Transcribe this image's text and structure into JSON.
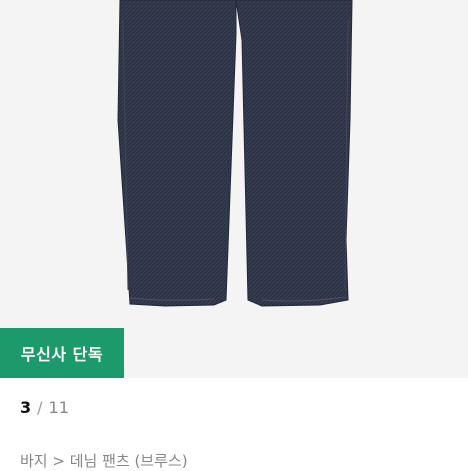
{
  "product": {
    "image_alt": "dark indigo denim pants",
    "exclusive_badge": "무신사 단독"
  },
  "pagination": {
    "current": "3",
    "separator": "/",
    "total": "11"
  },
  "breadcrumb": {
    "text": "바지 > 데님 팬츠 (브루스)"
  },
  "colors": {
    "badge_green": "#1c9a6c",
    "denim": "#2e3447",
    "image_bg": "#f4f4f4"
  }
}
